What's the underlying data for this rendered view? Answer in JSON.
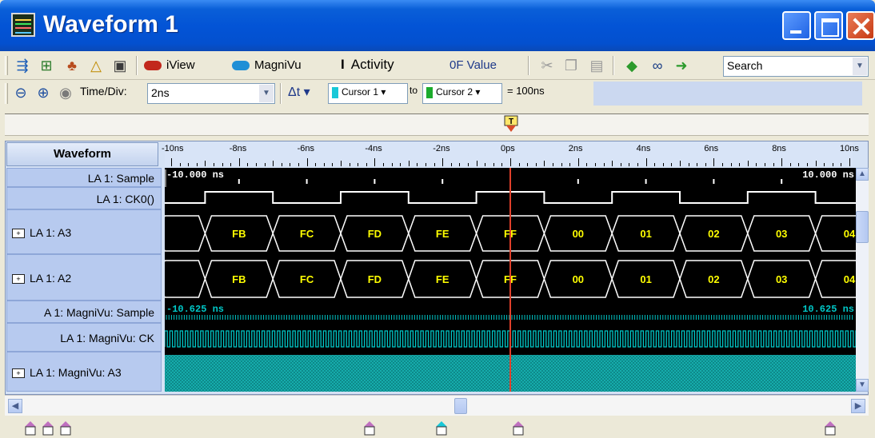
{
  "window": {
    "title": "Waveform 1"
  },
  "toolbar1": {
    "iview_label": "iView",
    "magnivu_label": "MagniVu",
    "activity_label": "Activity",
    "value_label": "0F Value",
    "search_value": "Search"
  },
  "toolbar2": {
    "timediv_label": "Time/Div:",
    "timediv_value": "2ns",
    "delta_label": "Δt",
    "cursor1_label": "Cursor 1",
    "to_label": "to",
    "cursor2_label": "Cursor 2",
    "delta_value": "= 100ns"
  },
  "ruler": {
    "header": "Waveform",
    "ticks": [
      "-10ns",
      "-8ns",
      "-6ns",
      "-4ns",
      "-2ns",
      "0ps",
      "2ns",
      "4ns",
      "6ns",
      "8ns",
      "10ns"
    ]
  },
  "channels": [
    {
      "name": "LA 1: Sample",
      "expandable": false
    },
    {
      "name": "LA 1: CK0()",
      "expandable": false
    },
    {
      "name": "LA 1: A3",
      "expandable": true
    },
    {
      "name": "LA 1: A2",
      "expandable": true
    },
    {
      "name": "A 1: MagniVu: Sample",
      "expandable": false
    },
    {
      "name": "LA 1: MagniVu: CK",
      "expandable": false
    },
    {
      "name": "LA 1: MagniVu: A3",
      "expandable": true
    }
  ],
  "scope": {
    "sample_start": "-10.000 ns",
    "sample_end": "10.000 ns",
    "magnivu_start": "-10.625 ns",
    "magnivu_end": "10.625 ns",
    "bus_values": [
      "FB",
      "FC",
      "FD",
      "FE",
      "FF",
      "00",
      "01",
      "02",
      "03",
      "04"
    ],
    "colors": {
      "background": "#000000",
      "trace": "#ffffff",
      "bus_text": "#ffff00",
      "magnivu": "#00c8c8",
      "trigger": "#e0402a"
    }
  }
}
